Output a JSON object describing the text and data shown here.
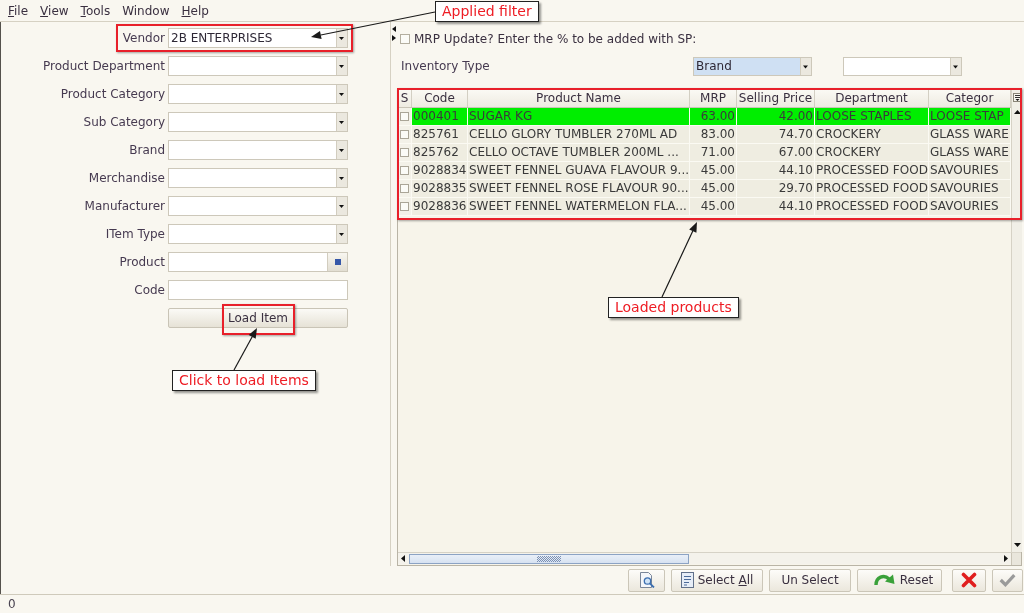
{
  "menu": [
    {
      "key": "F",
      "after": "ile"
    },
    {
      "key": "V",
      "after": "iew"
    },
    {
      "key": "T",
      "after": "ools"
    },
    {
      "before": "Window"
    },
    {
      "key": "H",
      "after": "elp"
    }
  ],
  "filters": [
    {
      "label": "Vendor",
      "kind": "dropdown",
      "value": "2B ENTERPRISES",
      "highlighted": true
    },
    {
      "label": "Product Department",
      "kind": "dropdown",
      "highlighted": false
    },
    {
      "label": "Product Category",
      "kind": "dropdown",
      "highlighted": false
    },
    {
      "label": "Sub Category",
      "kind": "dropdown",
      "highlighted": false
    },
    {
      "label": "Brand",
      "kind": "dropdown",
      "highlighted": false
    },
    {
      "label": "Merchandise",
      "kind": "dropdown",
      "highlighted": false
    },
    {
      "label": "Manufacturer",
      "kind": "dropdown",
      "highlighted": false
    },
    {
      "label": "ITem Type",
      "kind": "dropdown",
      "highlighted": false
    },
    {
      "label": "Product",
      "kind": "lookup",
      "highlighted": false
    },
    {
      "label": "Code",
      "kind": "text",
      "highlighted": false
    }
  ],
  "load_button": {
    "label": "Load Item",
    "highlighted": true
  },
  "mrp_update": {
    "label": "MRP Update? Enter the % to be added with SP:",
    "checked": false
  },
  "inventory_type": {
    "label": "Inventory Type",
    "selectors": [
      {
        "value": "Brand",
        "focused": true
      },
      {
        "focused": false
      }
    ]
  },
  "table": {
    "highlighted": true,
    "check_column": {
      "label": "S"
    },
    "columns": [
      {
        "label": "Code",
        "kind": "text"
      },
      {
        "label": "Product Name",
        "kind": "text"
      },
      {
        "label": "MRP",
        "kind": "number"
      },
      {
        "label": "Selling Price",
        "kind": "number"
      },
      {
        "label": "Department",
        "kind": "text"
      },
      {
        "label": "Categor",
        "kind": "text"
      }
    ],
    "rows": [
      {
        "selected": true,
        "checked": false,
        "cells": [
          "000401",
          "SUGAR KG",
          "63.00",
          "42.00",
          "LOOSE STAPLES",
          "LOOSE STAP"
        ]
      },
      {
        "selected": false,
        "checked": false,
        "cells": [
          "825761",
          "CELLO GLORY TUMBLER 270ML AD",
          "83.00",
          "74.70",
          "CROCKERY",
          "GLASS WARE"
        ]
      },
      {
        "selected": false,
        "checked": false,
        "cells": [
          "825762",
          "CELLO OCTAVE TUMBLER 200ML ...",
          "71.00",
          "67.00",
          "CROCKERY",
          "GLASS WARE"
        ]
      },
      {
        "selected": false,
        "checked": false,
        "cells": [
          "9028834",
          "SWEET FENNEL GUAVA FLAVOUR 9...",
          "45.00",
          "44.10",
          "PROCESSED FOOD",
          "SAVOURIES"
        ]
      },
      {
        "selected": false,
        "checked": false,
        "cells": [
          "9028835",
          "SWEET FENNEL ROSE FLAVOUR 90...",
          "45.00",
          "29.70",
          "PROCESSED FOOD",
          "SAVOURIES"
        ]
      },
      {
        "selected": false,
        "checked": false,
        "cells": [
          "9028836",
          "SWEET FENNEL WATERMELON FLA...",
          "45.00",
          "44.10",
          "PROCESSED FOOD",
          "SAVOURIES"
        ]
      }
    ]
  },
  "toolbar": [
    {
      "kind": "preview",
      "disabled": false
    },
    {
      "kind": "selectall",
      "before": "Select ",
      "key": "A",
      "after": "ll",
      "disabled": false
    },
    {
      "kind": "unselect",
      "before": "Un Select",
      "disabled": false
    },
    {
      "kind": "reset",
      "before": "Reset",
      "disabled": false
    },
    {
      "kind": "cancel",
      "disabled": false
    },
    {
      "kind": "confirm",
      "disabled": true
    }
  ],
  "status_bar": {
    "text": "0"
  },
  "annotations": [
    {
      "text": "Applied filter"
    },
    {
      "text": "Loaded products"
    },
    {
      "text": "Click to load Items"
    }
  ]
}
